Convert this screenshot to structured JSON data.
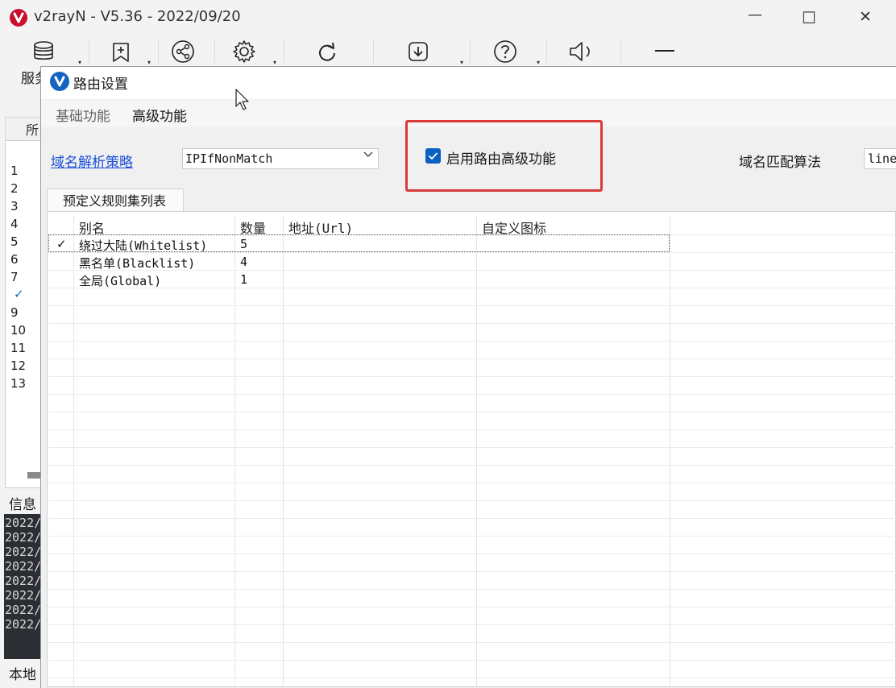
{
  "window": {
    "title": "v2rayN - V5.36 - 2022/09/20",
    "controls": {
      "minimize": "—",
      "maximize": "☐",
      "close": "✕"
    }
  },
  "toolbar": {
    "servers_label_fragment": "服务",
    "icons": [
      "database-icon",
      "add-server-icon",
      "share-icon",
      "settings-icon",
      "refresh-icon",
      "download-icon",
      "help-icon",
      "volume-icon",
      "minimize-dash-icon"
    ]
  },
  "background": {
    "tab_label_fragment": "所",
    "row_numbers": [
      "1",
      "2",
      "3",
      "4",
      "5",
      "6",
      "7",
      "✓",
      "9",
      "10",
      "11",
      "12",
      "13"
    ],
    "info_label_fragment": "信息",
    "log_lines": [
      "2022/",
      "2022/",
      "2022/",
      "2022/",
      "2022/",
      "2022/",
      "2022/",
      "2022/"
    ],
    "status_label_fragment": "本地"
  },
  "dialog": {
    "title": "路由设置",
    "tabs": [
      {
        "label": "基础功能",
        "active": false
      },
      {
        "label": "高级功能",
        "active": true
      }
    ],
    "domain_strategy": {
      "label": "域名解析策略",
      "value": "IPIfNonMatch"
    },
    "enable_advanced": {
      "label": "启用路由高级功能",
      "checked": true
    },
    "domain_matcher": {
      "label": "域名匹配算法",
      "value": "line"
    },
    "ruleset_tab": "预定义规则集列表",
    "table": {
      "columns": [
        "别名",
        "数量",
        "地址(Url)",
        "自定义图标"
      ],
      "rows": [
        {
          "check": "✓",
          "alias": "绕过大陆(Whitelist)",
          "count": "5",
          "url": "",
          "icon": ""
        },
        {
          "check": "",
          "alias": "黑名单(Blacklist)",
          "count": "4",
          "url": "",
          "icon": ""
        },
        {
          "check": "",
          "alias": "全局(Global)",
          "count": "1",
          "url": "",
          "icon": ""
        }
      ]
    }
  },
  "colors": {
    "highlight": "#d93a3a",
    "link": "#1a4fd8",
    "checkbox": "#0a5fc1",
    "logo_red": "#c8102e",
    "logo_blue": "#1565c0"
  }
}
